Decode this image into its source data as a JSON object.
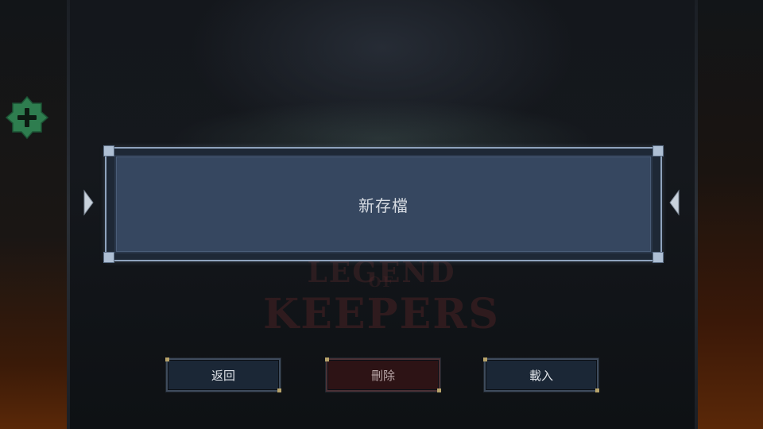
{
  "save_slot": {
    "label": "新存檔"
  },
  "background_logo": {
    "line1": "LEGEND",
    "line2": "OF",
    "line3": "KEEPERS"
  },
  "buttons": {
    "back_label": "返回",
    "delete_label": "刪除",
    "load_label": "載入"
  },
  "icons": {
    "add": "plus-icon",
    "prev": "arrow-left-icon",
    "next": "arrow-right-icon"
  },
  "colors": {
    "add_button": "#2e7d4f",
    "slot_fill": "#364760",
    "slot_border": "#8fa3bd",
    "delete_button": "#2d1315",
    "button_fill": "#1b2736"
  }
}
